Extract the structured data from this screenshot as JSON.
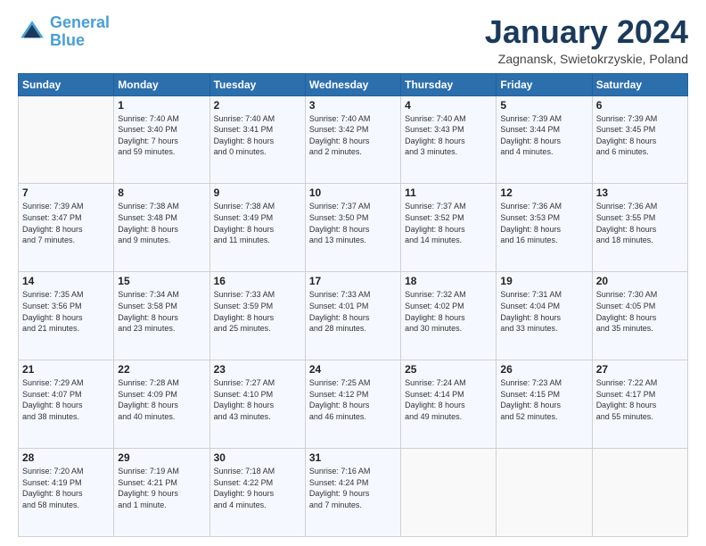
{
  "logo": {
    "line1": "General",
    "line2": "Blue"
  },
  "title": "January 2024",
  "location": "Zagnansk, Swietokrzyskie, Poland",
  "weekdays": [
    "Sunday",
    "Monday",
    "Tuesday",
    "Wednesday",
    "Thursday",
    "Friday",
    "Saturday"
  ],
  "weeks": [
    [
      {
        "day": "",
        "info": ""
      },
      {
        "day": "1",
        "info": "Sunrise: 7:40 AM\nSunset: 3:40 PM\nDaylight: 7 hours\nand 59 minutes."
      },
      {
        "day": "2",
        "info": "Sunrise: 7:40 AM\nSunset: 3:41 PM\nDaylight: 8 hours\nand 0 minutes."
      },
      {
        "day": "3",
        "info": "Sunrise: 7:40 AM\nSunset: 3:42 PM\nDaylight: 8 hours\nand 2 minutes."
      },
      {
        "day": "4",
        "info": "Sunrise: 7:40 AM\nSunset: 3:43 PM\nDaylight: 8 hours\nand 3 minutes."
      },
      {
        "day": "5",
        "info": "Sunrise: 7:39 AM\nSunset: 3:44 PM\nDaylight: 8 hours\nand 4 minutes."
      },
      {
        "day": "6",
        "info": "Sunrise: 7:39 AM\nSunset: 3:45 PM\nDaylight: 8 hours\nand 6 minutes."
      }
    ],
    [
      {
        "day": "7",
        "info": "Sunrise: 7:39 AM\nSunset: 3:47 PM\nDaylight: 8 hours\nand 7 minutes."
      },
      {
        "day": "8",
        "info": "Sunrise: 7:38 AM\nSunset: 3:48 PM\nDaylight: 8 hours\nand 9 minutes."
      },
      {
        "day": "9",
        "info": "Sunrise: 7:38 AM\nSunset: 3:49 PM\nDaylight: 8 hours\nand 11 minutes."
      },
      {
        "day": "10",
        "info": "Sunrise: 7:37 AM\nSunset: 3:50 PM\nDaylight: 8 hours\nand 13 minutes."
      },
      {
        "day": "11",
        "info": "Sunrise: 7:37 AM\nSunset: 3:52 PM\nDaylight: 8 hours\nand 14 minutes."
      },
      {
        "day": "12",
        "info": "Sunrise: 7:36 AM\nSunset: 3:53 PM\nDaylight: 8 hours\nand 16 minutes."
      },
      {
        "day": "13",
        "info": "Sunrise: 7:36 AM\nSunset: 3:55 PM\nDaylight: 8 hours\nand 18 minutes."
      }
    ],
    [
      {
        "day": "14",
        "info": "Sunrise: 7:35 AM\nSunset: 3:56 PM\nDaylight: 8 hours\nand 21 minutes."
      },
      {
        "day": "15",
        "info": "Sunrise: 7:34 AM\nSunset: 3:58 PM\nDaylight: 8 hours\nand 23 minutes."
      },
      {
        "day": "16",
        "info": "Sunrise: 7:33 AM\nSunset: 3:59 PM\nDaylight: 8 hours\nand 25 minutes."
      },
      {
        "day": "17",
        "info": "Sunrise: 7:33 AM\nSunset: 4:01 PM\nDaylight: 8 hours\nand 28 minutes."
      },
      {
        "day": "18",
        "info": "Sunrise: 7:32 AM\nSunset: 4:02 PM\nDaylight: 8 hours\nand 30 minutes."
      },
      {
        "day": "19",
        "info": "Sunrise: 7:31 AM\nSunset: 4:04 PM\nDaylight: 8 hours\nand 33 minutes."
      },
      {
        "day": "20",
        "info": "Sunrise: 7:30 AM\nSunset: 4:05 PM\nDaylight: 8 hours\nand 35 minutes."
      }
    ],
    [
      {
        "day": "21",
        "info": "Sunrise: 7:29 AM\nSunset: 4:07 PM\nDaylight: 8 hours\nand 38 minutes."
      },
      {
        "day": "22",
        "info": "Sunrise: 7:28 AM\nSunset: 4:09 PM\nDaylight: 8 hours\nand 40 minutes."
      },
      {
        "day": "23",
        "info": "Sunrise: 7:27 AM\nSunset: 4:10 PM\nDaylight: 8 hours\nand 43 minutes."
      },
      {
        "day": "24",
        "info": "Sunrise: 7:25 AM\nSunset: 4:12 PM\nDaylight: 8 hours\nand 46 minutes."
      },
      {
        "day": "25",
        "info": "Sunrise: 7:24 AM\nSunset: 4:14 PM\nDaylight: 8 hours\nand 49 minutes."
      },
      {
        "day": "26",
        "info": "Sunrise: 7:23 AM\nSunset: 4:15 PM\nDaylight: 8 hours\nand 52 minutes."
      },
      {
        "day": "27",
        "info": "Sunrise: 7:22 AM\nSunset: 4:17 PM\nDaylight: 8 hours\nand 55 minutes."
      }
    ],
    [
      {
        "day": "28",
        "info": "Sunrise: 7:20 AM\nSunset: 4:19 PM\nDaylight: 8 hours\nand 58 minutes."
      },
      {
        "day": "29",
        "info": "Sunrise: 7:19 AM\nSunset: 4:21 PM\nDaylight: 9 hours\nand 1 minute."
      },
      {
        "day": "30",
        "info": "Sunrise: 7:18 AM\nSunset: 4:22 PM\nDaylight: 9 hours\nand 4 minutes."
      },
      {
        "day": "31",
        "info": "Sunrise: 7:16 AM\nSunset: 4:24 PM\nDaylight: 9 hours\nand 7 minutes."
      },
      {
        "day": "",
        "info": ""
      },
      {
        "day": "",
        "info": ""
      },
      {
        "day": "",
        "info": ""
      }
    ]
  ]
}
